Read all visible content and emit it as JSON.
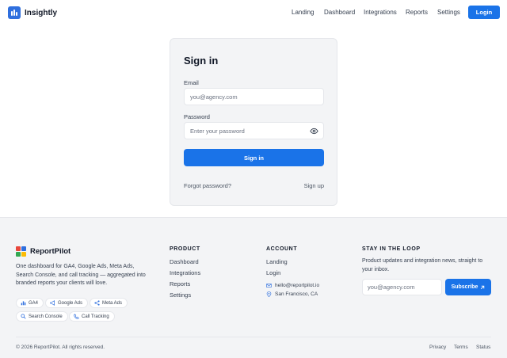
{
  "nav": {
    "brand": "Insightly",
    "links": [
      "Landing",
      "Dashboard",
      "Integrations",
      "Reports",
      "Settings"
    ],
    "login_label": "Login"
  },
  "signin": {
    "title": "Sign in",
    "email_label": "Email",
    "email_placeholder": "you@agency.com",
    "password_label": "Password",
    "password_placeholder": "Enter your password",
    "submit_label": "Sign in",
    "forgot_label": "Forgot password?",
    "signup_label": "Sign up"
  },
  "footer": {
    "brand": "ReportPilot",
    "logo_colors": [
      "#e8473c",
      "#2f6fde",
      "#34a853",
      "#fbbc05"
    ],
    "description": "One dashboard for GA4, Google Ads, Meta Ads, Search Console, and call tracking — aggregated into branded reports your clients will love.",
    "chips": [
      {
        "label": "GA4",
        "icon": "bar-chart-icon"
      },
      {
        "label": "Google Ads",
        "icon": "megaphone-icon"
      },
      {
        "label": "Meta Ads",
        "icon": "share-icon"
      },
      {
        "label": "Search Console",
        "icon": "search-icon"
      },
      {
        "label": "Call Tracking",
        "icon": "phone-icon"
      }
    ],
    "product": {
      "heading": "PRODUCT",
      "links": [
        "Dashboard",
        "Integrations",
        "Reports",
        "Settings"
      ]
    },
    "account": {
      "heading": "ACCOUNT",
      "links": [
        "Landing",
        "Login"
      ],
      "email": "hello@reportpilot.io",
      "location": "San Francisco, CA"
    },
    "newsletter": {
      "heading": "STAY IN THE LOOP",
      "text": "Product updates and integration news, straight to your inbox.",
      "placeholder": "you@agency.com",
      "button_label": "Subscribe"
    },
    "copyright": "© 2026 ReportPilot. All rights reserved.",
    "legal_links": [
      "Privacy",
      "Terms",
      "Status"
    ]
  }
}
